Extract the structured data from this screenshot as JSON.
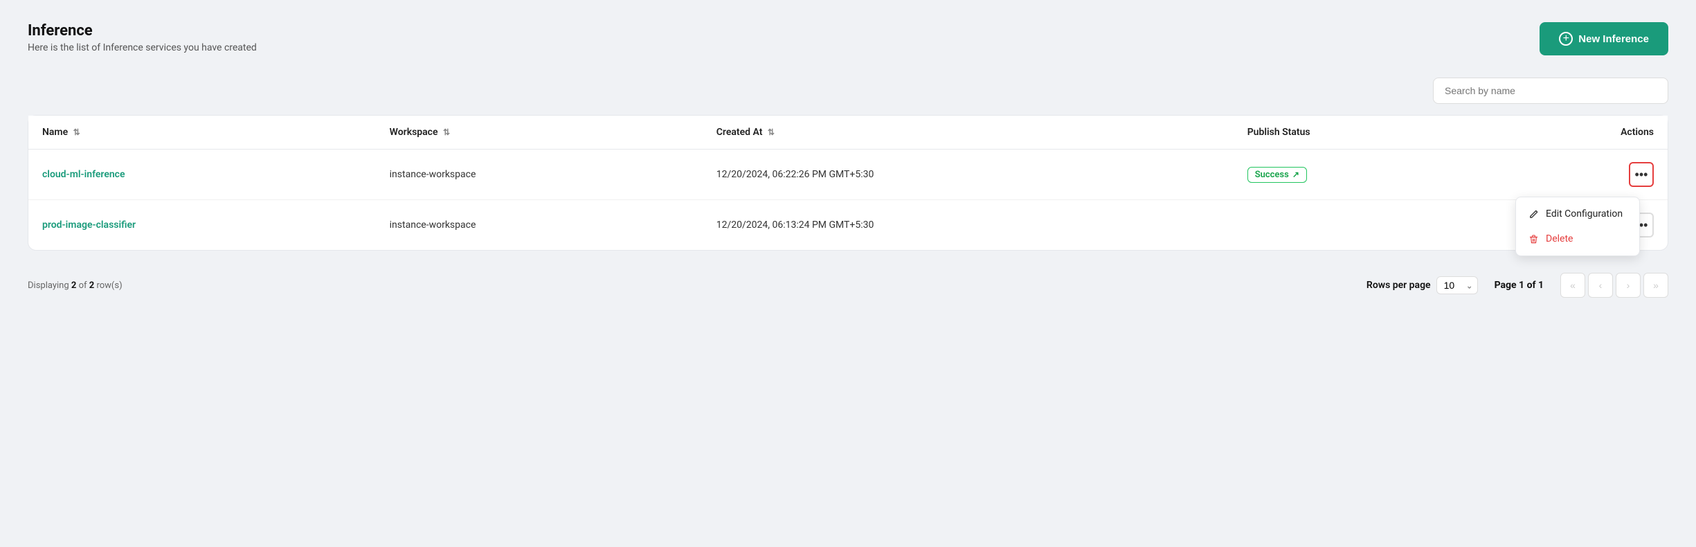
{
  "header": {
    "title": "Inference",
    "subtitle": "Here is the list of Inference services you have created",
    "new_button_label": "New Inference"
  },
  "search": {
    "placeholder": "Search by name"
  },
  "table": {
    "columns": [
      {
        "key": "name",
        "label": "Name",
        "sortable": true
      },
      {
        "key": "workspace",
        "label": "Workspace",
        "sortable": true
      },
      {
        "key": "created_at",
        "label": "Created At",
        "sortable": true
      },
      {
        "key": "publish_status",
        "label": "Publish Status",
        "sortable": false
      },
      {
        "key": "actions",
        "label": "Actions",
        "sortable": false
      }
    ],
    "rows": [
      {
        "name": "cloud-ml-inference",
        "workspace": "instance-workspace",
        "created_at": "12/20/2024, 06:22:26 PM GMT+5:30",
        "publish_status": "Success"
      },
      {
        "name": "prod-image-classifier",
        "workspace": "instance-workspace",
        "created_at": "12/20/2024, 06:13:24 PM GMT+5:30",
        "publish_status": null
      }
    ]
  },
  "footer": {
    "display_text": "Displaying",
    "display_count": "2",
    "display_of": "of",
    "display_total": "2",
    "display_rows": "row(s)",
    "rows_per_page_label": "Rows per page",
    "rows_per_page_value": "10",
    "page_label": "Page 1 of 1"
  },
  "dropdown": {
    "edit_label": "Edit Configuration",
    "delete_label": "Delete"
  },
  "colors": {
    "brand": "#1a9b7b",
    "delete_red": "#e53e3e",
    "success_green": "#22c55e",
    "success_text": "#16a34a"
  }
}
